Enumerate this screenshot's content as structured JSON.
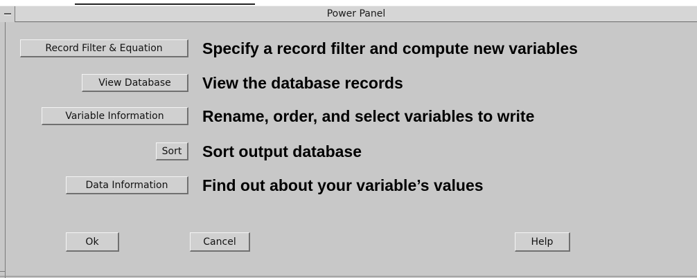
{
  "window": {
    "title": "Power Panel"
  },
  "options": [
    {
      "button_label": "Record Filter & Equation",
      "description": "Specify a record filter and compute new variables"
    },
    {
      "button_label": "View Database",
      "description": "View the database records"
    },
    {
      "button_label": "Variable Information",
      "description": "Rename, order, and select variables to write"
    },
    {
      "button_label": "Sort",
      "description": "Sort output database"
    },
    {
      "button_label": "Data Information",
      "description": "Find out about your variable’s values"
    }
  ],
  "actions": {
    "ok_label": "Ok",
    "cancel_label": "Cancel",
    "help_label": "Help"
  },
  "colors": {
    "window_background": "#c8c8c8",
    "text": "#000000"
  }
}
